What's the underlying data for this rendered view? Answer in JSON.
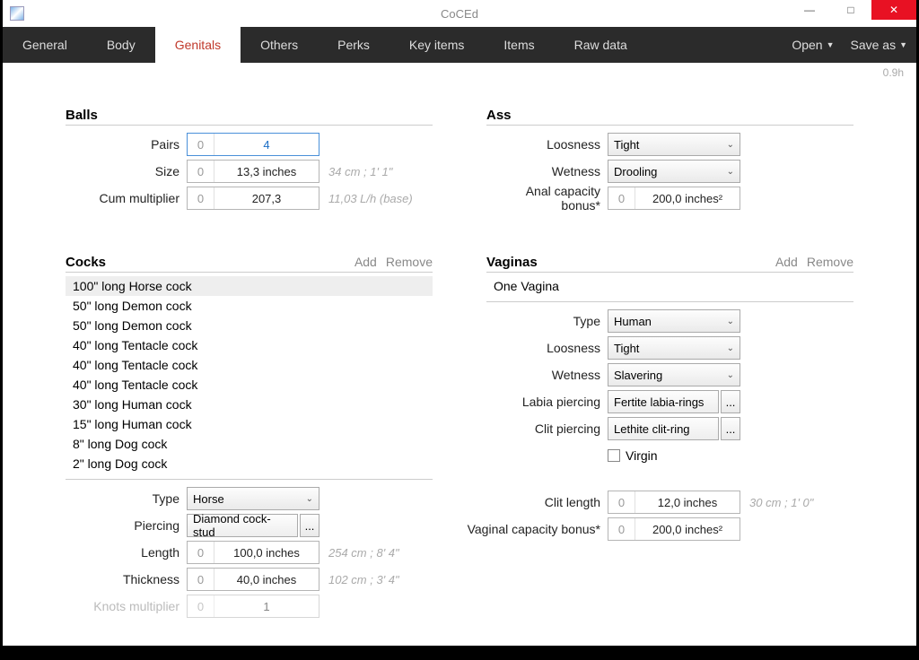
{
  "app": {
    "title": "CoCEd",
    "version": "0.9h"
  },
  "window": {
    "min": "—",
    "max": "□",
    "close": "✕"
  },
  "tabs": [
    "General",
    "Body",
    "Genitals",
    "Others",
    "Perks",
    "Key items",
    "Items",
    "Raw data"
  ],
  "active_tab": 2,
  "topbar": {
    "open": "Open",
    "saveas": "Save as"
  },
  "balls": {
    "title": "Balls",
    "pairs": {
      "label": "Pairs",
      "curr": "0",
      "val": "4"
    },
    "size": {
      "label": "Size",
      "curr": "0",
      "val": "13,3 inches",
      "hint": "34 cm ; 1' 1\""
    },
    "cum": {
      "label": "Cum multiplier",
      "curr": "0",
      "val": "207,3",
      "hint": "11,03 L/h (base)"
    }
  },
  "ass": {
    "title": "Ass",
    "loosness": {
      "label": "Loosness",
      "val": "Tight"
    },
    "wetness": {
      "label": "Wetness",
      "val": "Drooling"
    },
    "capacity": {
      "label": "Anal capacity bonus*",
      "curr": "0",
      "val": "200,0 inches²"
    }
  },
  "cocks": {
    "title": "Cocks",
    "add": "Add",
    "remove": "Remove",
    "items": [
      "100\" long Horse cock",
      "50\" long Demon cock",
      "50\" long Demon cock",
      "40\" long Tentacle cock",
      "40\" long Tentacle cock",
      "40\" long Tentacle cock",
      "30\" long Human cock",
      "15\" long Human cock",
      "8\" long Dog cock",
      "2\" long Dog cock"
    ],
    "selected": 0,
    "type": {
      "label": "Type",
      "val": "Horse"
    },
    "piercing": {
      "label": "Piercing",
      "val": "Diamond cock-stud"
    },
    "length": {
      "label": "Length",
      "curr": "0",
      "val": "100,0 inches",
      "hint": "254 cm ; 8' 4\""
    },
    "thickness": {
      "label": "Thickness",
      "curr": "0",
      "val": "40,0 inches",
      "hint": "102 cm ; 3' 4\""
    },
    "knots": {
      "label": "Knots multiplier",
      "curr": "0",
      "val": "1"
    }
  },
  "vaginas": {
    "title": "Vaginas",
    "add": "Add",
    "remove": "Remove",
    "items": [
      "One Vagina"
    ],
    "type": {
      "label": "Type",
      "val": "Human"
    },
    "loosness": {
      "label": "Loosness",
      "val": "Tight"
    },
    "wetness": {
      "label": "Wetness",
      "val": "Slavering"
    },
    "labia": {
      "label": "Labia piercing",
      "val": "Fertite labia-rings"
    },
    "clitp": {
      "label": "Clit piercing",
      "val": "Lethite clit-ring"
    },
    "virgin": "Virgin",
    "clitlen": {
      "label": "Clit length",
      "curr": "0",
      "val": "12,0 inches",
      "hint": "30 cm ; 1' 0\""
    },
    "capacity": {
      "label": "Vaginal capacity bonus*",
      "curr": "0",
      "val": "200,0 inches²"
    }
  }
}
